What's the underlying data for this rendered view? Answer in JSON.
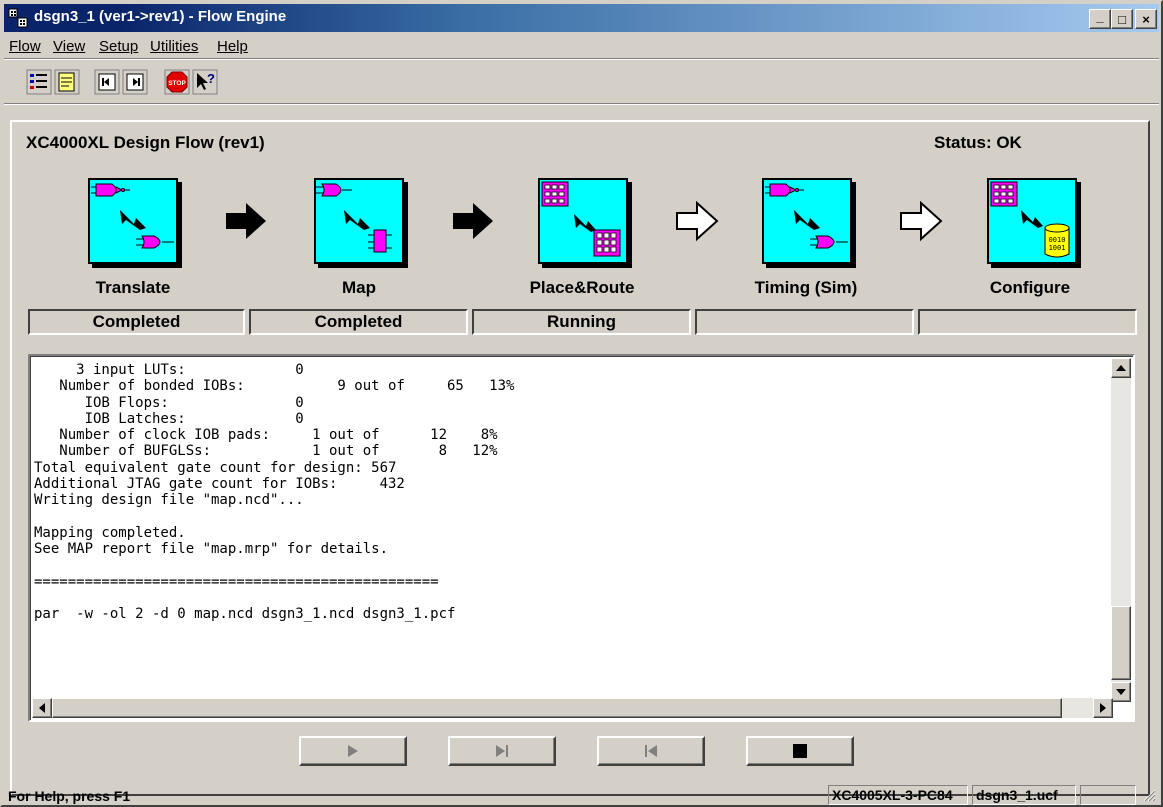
{
  "window": {
    "title": "dsgn3_1 (ver1->rev1) - Flow Engine",
    "controls": {
      "minimize": "_",
      "maximize": "□",
      "close": "×"
    }
  },
  "menu": [
    {
      "label": "Flow",
      "icon": ""
    },
    {
      "label": "View"
    },
    {
      "label": "Setup"
    },
    {
      "label": "Utilities"
    },
    {
      "label": "Help"
    }
  ],
  "toolbar": [
    {
      "name": "checklist-icon"
    },
    {
      "name": "report-icon"
    },
    {
      "name": "step-back-icon"
    },
    {
      "name": "step-forward-icon"
    },
    {
      "name": "stop-icon",
      "text": "STOP"
    },
    {
      "name": "context-help-icon",
      "text": "?"
    }
  ],
  "flow": {
    "title": "XC4000XL Design Flow (rev1)",
    "status": "Status: OK",
    "steps": [
      {
        "label": "Translate",
        "status": "Completed",
        "icon": "translate-icon"
      },
      {
        "label": "Map",
        "status": "Completed",
        "icon": "map-icon"
      },
      {
        "label": "Place&Route",
        "status": "Running",
        "icon": "place-route-icon"
      },
      {
        "label": "Timing (Sim)",
        "status": "",
        "icon": "timing-icon"
      },
      {
        "label": "Configure",
        "status": "",
        "icon": "configure-icon"
      }
    ],
    "arrows": [
      "filled",
      "filled",
      "outline",
      "outline"
    ]
  },
  "log": {
    "text": "     3 input LUTs:             0\n   Number of bonded IOBs:           9 out of     65   13%\n      IOB Flops:               0\n      IOB Latches:             0\n   Number of clock IOB pads:     1 out of      12    8%\n   Number of BUFGLSs:            1 out of       8   12%\nTotal equivalent gate count for design: 567\nAdditional JTAG gate count for IOBs:     432\nWriting design file \"map.ncd\"...\n\nMapping completed.\nSee MAP report file \"map.mrp\" for details.\n\n================================================\n\npar  -w -ol 2 -d 0 map.ncd dsgn3_1.ncd dsgn3_1.pcf"
  },
  "controls": [
    {
      "name": "run-button",
      "icon": "play-icon"
    },
    {
      "name": "step-button",
      "icon": "step-icon"
    },
    {
      "name": "rewind-button",
      "icon": "rewind-icon"
    },
    {
      "name": "stop-button",
      "icon": "stop-square-icon"
    }
  ],
  "statusbar": {
    "help": "For Help, press F1",
    "device": "XC4005XL-3-PC84",
    "ucf": "dsgn3_1.ucf"
  }
}
